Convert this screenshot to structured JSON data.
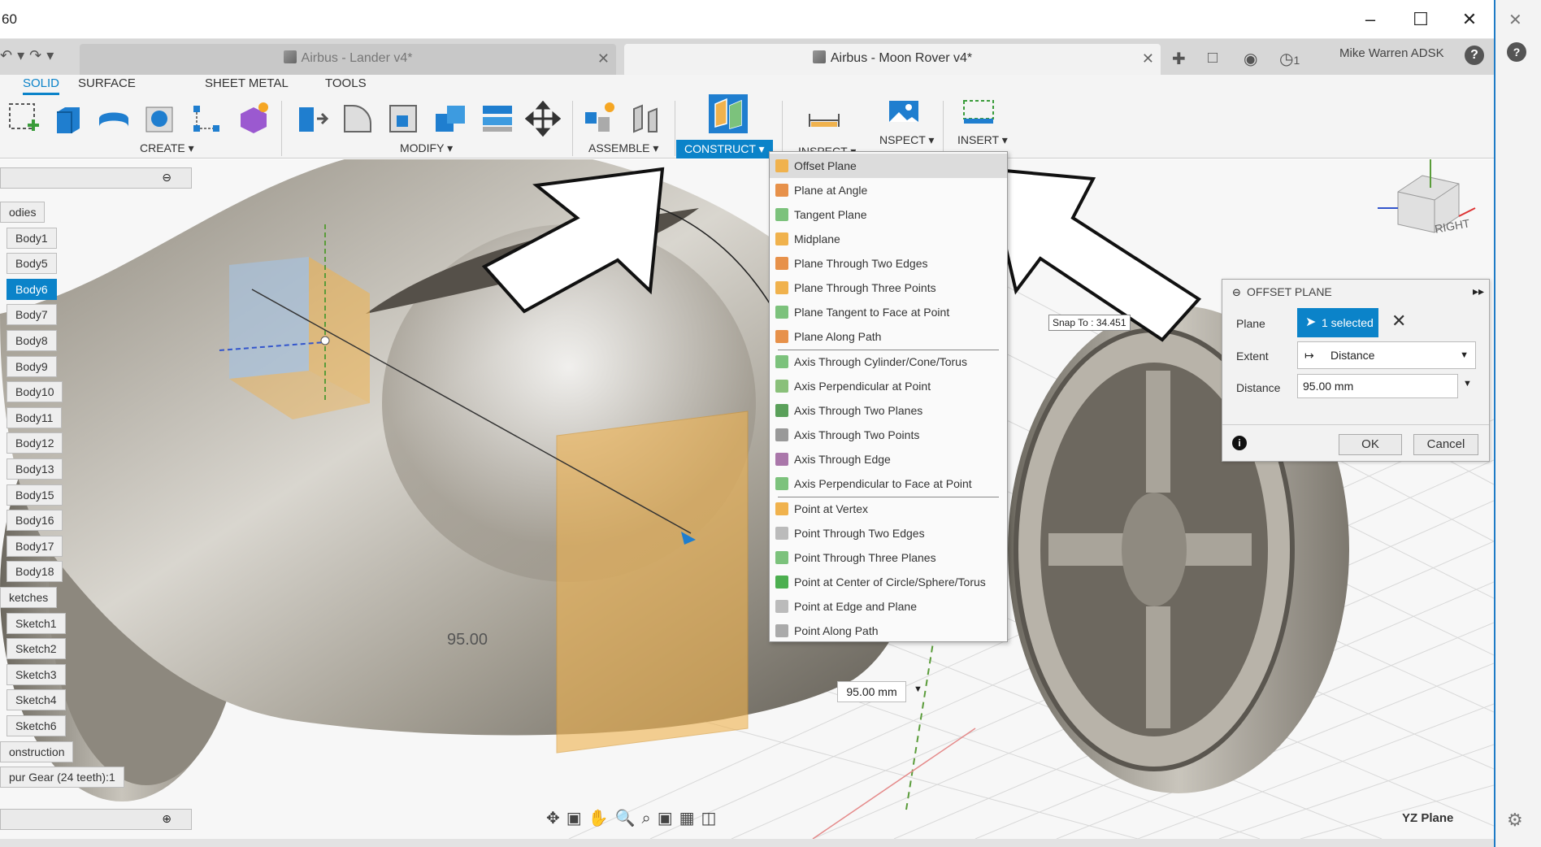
{
  "titlebar": {
    "title_fragment": "60"
  },
  "tabs": {
    "inactive": {
      "label": "Airbus - Lander v4*"
    },
    "active": {
      "label": "Airbus - Moon Rover v4*"
    }
  },
  "header_right": {
    "job_count": "1",
    "user": "Mike Warren ADSK",
    "help": "?"
  },
  "ribbon": {
    "workspace_tabs": [
      "SOLID",
      "SURFACE",
      "SHEET METAL",
      "TOOLS"
    ],
    "groups": {
      "create": "CREATE ▾",
      "modify": "MODIFY ▾",
      "assemble": "ASSEMBLE ▾",
      "construct": "CONSTRUCT ▾",
      "inspect_partial": "INSPECT ▾",
      "inspect": "NSPECT ▾",
      "insert": "INSERT ▾"
    }
  },
  "construct_menu": {
    "items": [
      "Offset Plane",
      "Plane at Angle",
      "Tangent Plane",
      "Midplane",
      "Plane Through Two Edges",
      "Plane Through Three Points",
      "Plane Tangent to Face at Point",
      "Plane Along Path",
      "Axis Through Cylinder/Cone/Torus",
      "Axis Perpendicular at Point",
      "Axis Through Two Planes",
      "Axis Through Two Points",
      "Axis Through Edge",
      "Axis Perpendicular to Face at Point",
      "Point at Vertex",
      "Point Through Two Edges",
      "Point Through Three Planes",
      "Point at Center of Circle/Sphere/Torus",
      "Point at Edge and Plane",
      "Point Along Path"
    ]
  },
  "browser": {
    "items": [
      "odies",
      "Body1",
      "Body5",
      "Body6",
      "Body7",
      "Body8",
      "Body9",
      "Body10",
      "Body11",
      "Body12",
      "Body13",
      "Body15",
      "Body16",
      "Body17",
      "Body18",
      "ketches",
      "Sketch1",
      "Sketch2",
      "Sketch3",
      "Sketch4",
      "Sketch6",
      "onstruction",
      "pur Gear (24 teeth):1"
    ],
    "selected": "Body6"
  },
  "dialog": {
    "title": "OFFSET PLANE",
    "plane_label": "Plane",
    "plane_value": "1 selected",
    "extent_label": "Extent",
    "extent_value": "Distance",
    "distance_label": "Distance",
    "distance_value": "95.00 mm",
    "ok": "OK",
    "cancel": "Cancel"
  },
  "viewport": {
    "snap_tip": "Snap To : 34.451",
    "distance_box": "95.00 mm",
    "dimension_label": "95.00",
    "plane_label": "YZ Plane",
    "viewcube_face": "RIGHT"
  },
  "colors": {
    "accent": "#0b83c9",
    "plane_fill": "#f0b24d"
  }
}
